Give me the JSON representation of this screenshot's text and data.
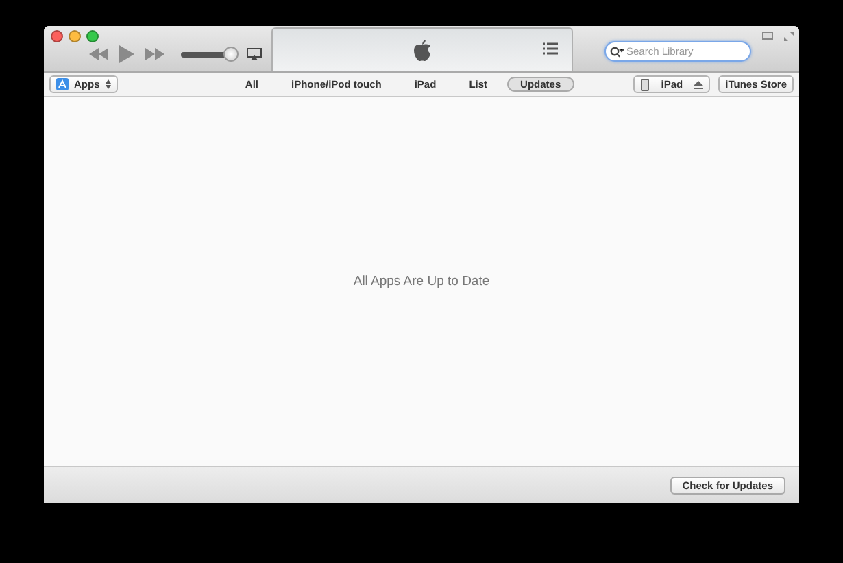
{
  "toolbar": {
    "volume": {
      "level": 0.9
    },
    "search": {
      "placeholder": "Search Library"
    }
  },
  "library_selector": {
    "label": "Apps"
  },
  "view_tabs": [
    {
      "label": "All",
      "selected": false
    },
    {
      "label": "iPhone/iPod touch",
      "selected": false
    },
    {
      "label": "iPad",
      "selected": false
    },
    {
      "label": "List",
      "selected": false
    },
    {
      "label": "Updates",
      "selected": true
    }
  ],
  "device": {
    "label": "iPad"
  },
  "store_button": {
    "label": "iTunes Store"
  },
  "message": "All Apps Are Up to Date",
  "footer": {
    "button": "Check for Updates"
  }
}
